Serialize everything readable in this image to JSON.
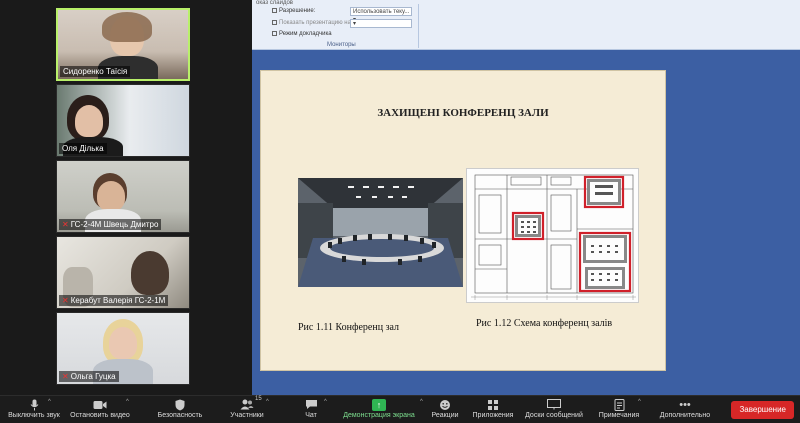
{
  "participants": [
    {
      "name": "Сидоренко Таїсія",
      "muted": false,
      "active": true
    },
    {
      "name": "Оля Дiлька",
      "muted": false,
      "active": false
    },
    {
      "name": "ГС-2-4М Швець Дмитро",
      "muted": true,
      "active": false
    },
    {
      "name": "Керабут Валерія ГС-2-1М",
      "muted": true,
      "active": false
    },
    {
      "name": "Ольга Гуцка",
      "muted": true,
      "active": false
    }
  ],
  "ribbon": {
    "tab_fragment": "оказ слайдов",
    "resolution_label": "Разрешение:",
    "resolution_value": "Использовать теку...",
    "show_on_label": "Показать презентацию на:",
    "presenter_view_label": "Режим докладчика",
    "group_label": "Мониторы"
  },
  "slide": {
    "title": "ЗАХИЩЕНІ КОНФЕРЕНЦ ЗАЛИ",
    "caption_left": "Рис 1.11 Конференц зал",
    "caption_right": "Рис 1.12 Схема конференц залів"
  },
  "toolbar": {
    "mute_label": "Выключить звук",
    "video_label": "Остановить видео",
    "security_label": "Безопасность",
    "participants_label": "Участники",
    "participants_count": "15",
    "chat_label": "Чат",
    "share_label": "Демонстрация экрана",
    "reactions_label": "Реакции",
    "apps_label": "Приложения",
    "whiteboard_label": "Доски сообщений",
    "notes_label": "Примечания",
    "more_label": "Дополнительно",
    "end_label": "Завершение"
  },
  "colors": {
    "share_accent": "#2fb553",
    "end_button": "#d72727",
    "active_speaker": "#b9f06a",
    "slide_bg": "#f5ecd6",
    "highlight_box": "#d0202a"
  }
}
